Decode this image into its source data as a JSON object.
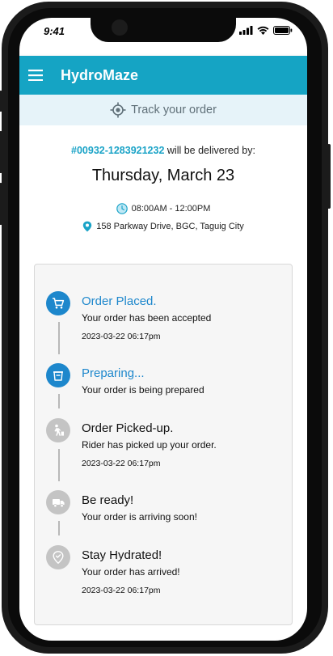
{
  "status_bar": {
    "time": "9:41"
  },
  "app": {
    "title": "HydroMaze"
  },
  "track": {
    "label": "Track your order"
  },
  "order": {
    "id": "#00932-1283921232",
    "delivered_by_text": " will be delivered by:",
    "date": "Thursday, March 23",
    "time_window": "08:00AM - 12:00PM",
    "address": "158 Parkway Drive, BGC, Taguig City"
  },
  "steps": [
    {
      "title": "Order Placed.",
      "desc": "Your order has been accepted",
      "time": "2023-03-22 06:17pm",
      "status": "active",
      "icon": "cart-icon"
    },
    {
      "title": "Preparing...",
      "desc": "Your order is being prepared",
      "time": "",
      "status": "active",
      "icon": "box-icon"
    },
    {
      "title": "Order Picked-up.",
      "desc": "Rider has picked up your order.",
      "time": "2023-03-22 06:17pm",
      "status": "inactive",
      "icon": "rider-icon"
    },
    {
      "title": "Be ready!",
      "desc": "Your order is arriving soon!",
      "time": "",
      "status": "inactive",
      "icon": "truck-icon"
    },
    {
      "title": "Stay Hydrated!",
      "desc": "Your order has arrived!",
      "time": "2023-03-22 06:17pm",
      "status": "inactive",
      "icon": "location-check-icon"
    }
  ],
  "colors": {
    "primary": "#15a4c4",
    "active_step": "#1d87cc",
    "inactive_step": "#c4c4c4",
    "track_bg": "#e6f3f9"
  }
}
